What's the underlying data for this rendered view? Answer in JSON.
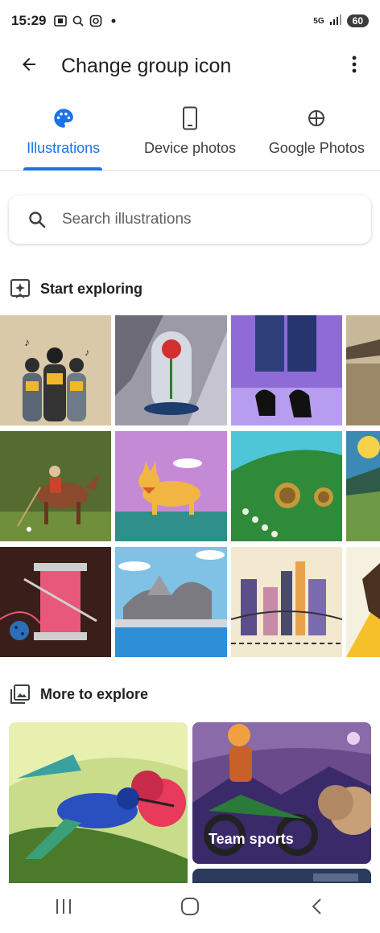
{
  "status_bar": {
    "time": "15:29",
    "network": "5G",
    "battery": "60"
  },
  "app_bar": {
    "title": "Change group icon"
  },
  "tabs": [
    {
      "label": "Illustrations",
      "icon": "palette-icon",
      "active": true
    },
    {
      "label": "Device photos",
      "icon": "smartphone-icon",
      "active": false
    },
    {
      "label": "Google Photos",
      "icon": "pinwheel-icon",
      "active": false
    }
  ],
  "search": {
    "placeholder": "Search illustrations"
  },
  "sections": {
    "start_exploring": {
      "title": "Start exploring",
      "icon": "sparkle-icon"
    },
    "more_to_explore": {
      "title": "More to explore",
      "icon": "photo-library-icon"
    }
  },
  "cards": [
    {
      "label": ""
    },
    {
      "label": "Team sports"
    }
  ],
  "colors": {
    "accent": "#1a73e8",
    "text": "#202124",
    "muted": "#5f6368"
  }
}
